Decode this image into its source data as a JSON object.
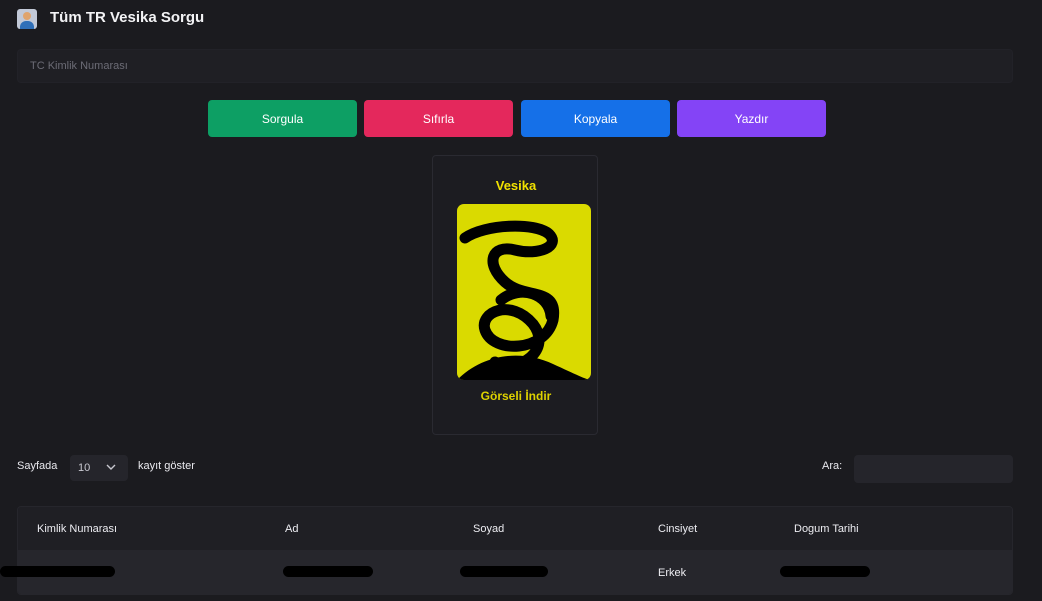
{
  "header": {
    "title": "Tüm TR Vesika Sorgu",
    "icon": "id-photo-icon"
  },
  "form": {
    "tc_placeholder": "TC Kimlik Numarası",
    "tc_value": ""
  },
  "buttons": {
    "query_label": "Sorgula",
    "reset_label": "Sıfırla",
    "copy_label": "Kopyala",
    "print_label": "Yazdır",
    "colors": {
      "query": "#0d9f64",
      "reset": "#e4285c",
      "copy": "#1570e8",
      "print": "#8444f6"
    }
  },
  "photo_card": {
    "title": "Vesika",
    "download_label": "Görseli İndir",
    "accent_color": "#f1e100"
  },
  "table_controls": {
    "length_prefix": "Sayfada",
    "length_value": "10",
    "length_suffix": "kayıt göster",
    "search_label": "Ara:",
    "search_value": ""
  },
  "table": {
    "columns": [
      "Kimlik Numarası",
      "Ad",
      "Soyad",
      "Cinsiyet",
      "Dogum Tarihi"
    ],
    "rows": [
      {
        "kimlik": "",
        "ad": "",
        "soyad": "",
        "cinsiyet": "Erkek",
        "dogum": ""
      }
    ]
  }
}
